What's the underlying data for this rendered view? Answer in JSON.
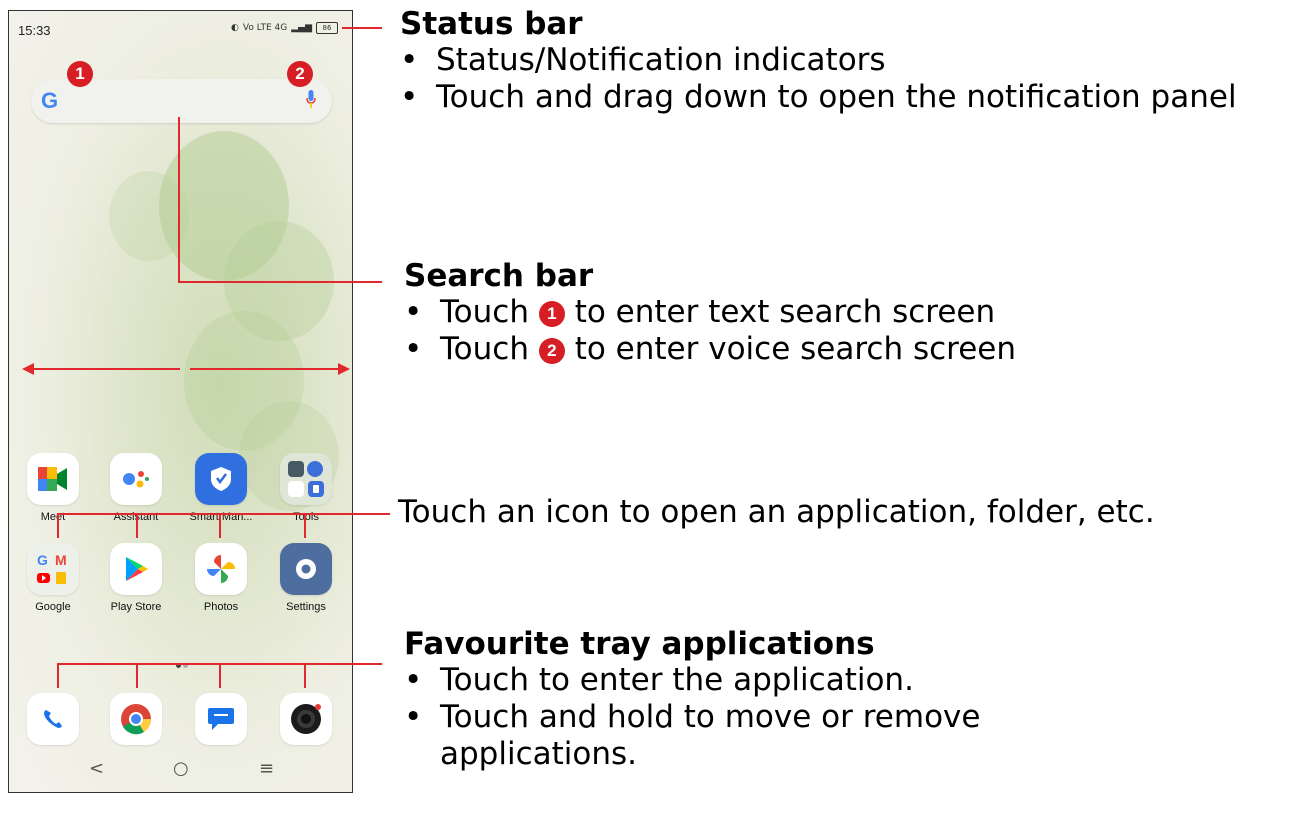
{
  "phone": {
    "status_time": "15:33",
    "status_network": "Vo LTE 4G",
    "battery": "86",
    "search_badges": [
      "1",
      "2"
    ],
    "apps_row1": [
      {
        "label": "Meet",
        "icon": "meet-icon"
      },
      {
        "label": "Assistant",
        "icon": "assistant-icon"
      },
      {
        "label": "Smart Man...",
        "icon": "smart-manager-icon"
      },
      {
        "label": "Tools",
        "icon": "tools-folder-icon"
      }
    ],
    "apps_row2": [
      {
        "label": "Google",
        "icon": "google-folder-icon"
      },
      {
        "label": "Play Store",
        "icon": "play-store-icon"
      },
      {
        "label": "Photos",
        "icon": "photos-icon"
      },
      {
        "label": "Settings",
        "icon": "settings-icon"
      }
    ],
    "tray": [
      "phone-icon",
      "chrome-icon",
      "messages-icon",
      "camera-icon"
    ],
    "nav": {
      "back": "<",
      "home": "○",
      "recents": "≡"
    }
  },
  "callouts": {
    "status_bar": {
      "title": "Status bar",
      "bullets": [
        "Status/Notification indicators",
        "Touch and drag down to open the notification panel"
      ]
    },
    "search_bar": {
      "title": "Search bar",
      "b1_pre": "Touch",
      "b1_num": "1",
      "b1_post": "to enter text search screen",
      "b2_pre": "Touch",
      "b2_num": "2",
      "b2_post": "to enter voice search screen"
    },
    "icon_note": "Touch an icon to open an application, folder, etc.",
    "favourite": {
      "title": "Favourite tray applications",
      "bullets": [
        "Touch to enter the application.",
        "Touch and hold to move or remove applications."
      ]
    }
  },
  "colors": {
    "accent_red": "#d71e25",
    "line_red": "#e0282e"
  }
}
